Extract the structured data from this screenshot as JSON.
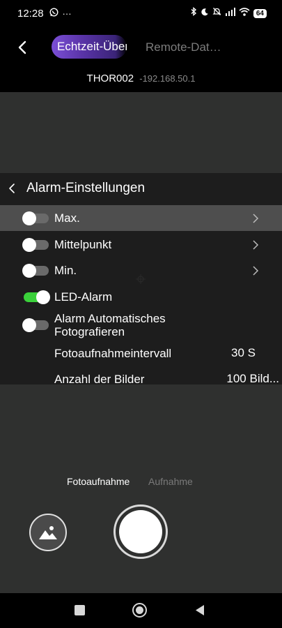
{
  "status_bar": {
    "time": "12:28",
    "left_icons": [
      "whatsapp-icon",
      "more-icon"
    ],
    "more_glyph": "···",
    "right_icons": [
      "bluetooth-icon",
      "do-not-disturb-icon",
      "mute-icon",
      "signal-icon",
      "wifi-icon"
    ],
    "battery": "64"
  },
  "header": {
    "tabs": [
      {
        "label": "Echtzeit-Überwachung",
        "active": true
      },
      {
        "label": "Remote-Dat…",
        "active": false
      }
    ],
    "device_name": "THOR002",
    "device_ip": "-192.168.50.1"
  },
  "alarm_panel": {
    "title": "Alarm-Einstellungen",
    "items": [
      {
        "label": "Max.",
        "enabled": false,
        "has_chevron": true
      },
      {
        "label": "Mittelpunkt",
        "enabled": false,
        "has_chevron": true
      },
      {
        "label": "Min.",
        "enabled": false,
        "has_chevron": true
      },
      {
        "label": "LED-Alarm",
        "enabled": true,
        "has_chevron": false
      },
      {
        "label": "Alarm Automatisches Fotografieren",
        "enabled": false,
        "has_chevron": false
      }
    ],
    "settings": [
      {
        "label": "Fotoaufnahmeintervall",
        "value": "30 S"
      },
      {
        "label": "Anzahl der Bilder",
        "value": "100 Bild..."
      }
    ]
  },
  "capture_modes": {
    "photo": "Fotoaufnahme",
    "video": "Aufnahme",
    "selected": "photo"
  },
  "colors": {
    "accent_gradient_start": "#7b4fd6",
    "toggle_on": "#3ad13a",
    "toggle_off": "#6a6a6a",
    "background": "#2f302f"
  }
}
